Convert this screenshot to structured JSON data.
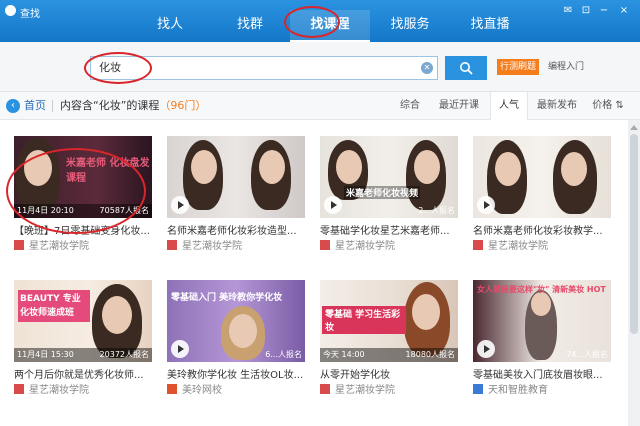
{
  "app": {
    "title": "查找",
    "icon": "qq-penguin-icon"
  },
  "window_controls": [
    "msg-icon",
    "pin-icon",
    "minimize-icon",
    "close-icon"
  ],
  "tabs": [
    {
      "label": "找人"
    },
    {
      "label": "找群"
    },
    {
      "label": "找课程",
      "active": true
    },
    {
      "label": "找服务"
    },
    {
      "label": "找直播"
    }
  ],
  "search": {
    "value": "化妆",
    "button_icon": "search-icon",
    "chip": "行测刷题",
    "entry": "编程入门"
  },
  "filter": {
    "home": "首页",
    "crumb_prefix": "内容含“化妆”的课程",
    "crumb_count": "（96门）",
    "sort": [
      "综合",
      "最近开课",
      "人气",
      "最新发布",
      "价格 ⇅"
    ],
    "active_sort": "人气"
  },
  "courses": [
    {
      "title": "【晚班】7日零基础变身化妆...",
      "school": "星艺潮妆学院",
      "date": "11月4日 20:10",
      "enroll": "70587人报名",
      "thumb_text": "米嘉老师 化妆盘发课程"
    },
    {
      "title": "名师米嘉老师化妆彩妆造型...",
      "school": "星艺潮妆学院",
      "date": "",
      "enroll": "",
      "thumb_text": ""
    },
    {
      "title": "零基础学化妆星艺米嘉老师...",
      "school": "星艺潮妆学院",
      "date": "",
      "enroll": "2...人报名",
      "thumb_text": "米嘉老师化妆视频"
    },
    {
      "title": "名师米嘉老师化妆彩妆教学...",
      "school": "星艺潮妆学院",
      "date": "",
      "enroll": "",
      "thumb_text": ""
    },
    {
      "title": "两个月后你就是优秀化妆师...",
      "school": "星艺潮妆学院",
      "date": "11月4日 15:30",
      "enroll": "20372人报名",
      "thumb_text": "BEAUTY 专业化妆师速成班"
    },
    {
      "title": "美玲教你学化妆 生活妆OL妆...",
      "school": "美玲网校",
      "date": "",
      "enroll": "6...人报名",
      "thumb_text": "零基础入门 美玲教你学化妆"
    },
    {
      "title": "从零开始学化妆",
      "school": "星艺潮妆学院",
      "date": "今天 14:00",
      "enroll": "18080人报名",
      "thumb_text": "零基础 学习生活彩妆"
    },
    {
      "title": "零基础美妆入门底妆眉妆眼...",
      "school": "天和智胜教育",
      "date": "",
      "enroll": "74...人报名",
      "thumb_text": "女人就是要这样\"妆\" 清新美妆 HOT"
    }
  ]
}
